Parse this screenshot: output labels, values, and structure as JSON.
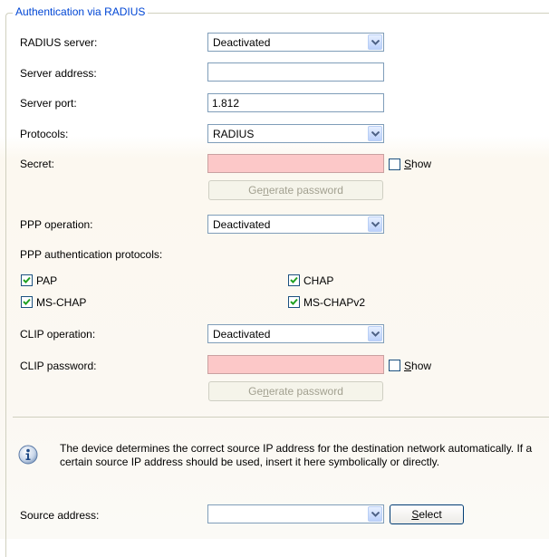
{
  "group": {
    "title": "Authentication via RADIUS"
  },
  "radius_server": {
    "label": "RADIUS server:",
    "value": "Deactivated"
  },
  "server_address": {
    "label": "Server address:",
    "value": ""
  },
  "server_port": {
    "label": "Server port:",
    "value": "1.812"
  },
  "protocols": {
    "label": "Protocols:",
    "value": "RADIUS"
  },
  "secret": {
    "label": "Secret:",
    "show_label": "Show",
    "generate_label": "Generate password",
    "show_checked": false
  },
  "ppp_operation": {
    "label": "PPP operation:",
    "value": "Deactivated"
  },
  "ppp_auth": {
    "label": "PPP authentication protocols:",
    "pap": {
      "label": "PAP",
      "checked": true
    },
    "chap": {
      "label": "CHAP",
      "checked": true
    },
    "ms_chap": {
      "label": "MS-CHAP",
      "checked": true
    },
    "ms_chapv2": {
      "label": "MS-CHAPv2",
      "checked": true
    }
  },
  "clip_operation": {
    "label": "CLIP operation:",
    "value": "Deactivated"
  },
  "clip_password": {
    "label": "CLIP password:",
    "show_label": "Show",
    "generate_label": "Generate password",
    "show_checked": false
  },
  "info": {
    "text": "The device determines the correct source IP address for the destination network automatically. If a certain source IP address should be used, insert it here symbolically or directly.",
    "icon": "info-icon"
  },
  "source_address": {
    "label": "Source address:",
    "value": "",
    "select_label": "Select"
  },
  "colors": {
    "title": "#0046d5",
    "password_bg": "#fcc8c8",
    "checkmark": "#21a121"
  }
}
